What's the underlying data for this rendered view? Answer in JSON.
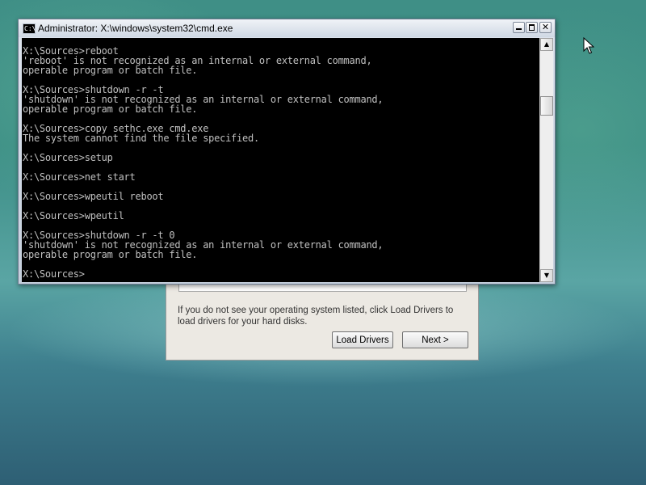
{
  "cmd_window": {
    "title": "Administrator: X:\\windows\\system32\\cmd.exe",
    "icon_text": "C:\\",
    "controls": {
      "minimize": "minimize-icon",
      "maximize": "maximize-icon",
      "close": "close-icon"
    },
    "scrollbar": {
      "up_icon": "up-arrow-icon",
      "down_icon": "down-arrow-icon"
    },
    "console_lines": [
      "X:\\Sources>reboot",
      "'reboot' is not recognized as an internal or external command,",
      "operable program or batch file.",
      "",
      "X:\\Sources>shutdown -r -t",
      "'shutdown' is not recognized as an internal or external command,",
      "operable program or batch file.",
      "",
      "X:\\Sources>copy sethc.exe cmd.exe",
      "The system cannot find the file specified.",
      "",
      "X:\\Sources>setup",
      "",
      "X:\\Sources>net start",
      "",
      "X:\\Sources>wpeutil reboot",
      "",
      "X:\\Sources>wpeutil",
      "",
      "X:\\Sources>shutdown -r -t 0",
      "'shutdown' is not recognized as an internal or external command,",
      "operable program or batch file.",
      "",
      "X:\\Sources>"
    ]
  },
  "setup_dialog": {
    "hint": "If you do not see your operating system listed, click Load Drivers to load drivers for your hard disks.",
    "load_drivers_label": "Load Drivers",
    "next_label": "Next >"
  },
  "colors": {
    "console_background": "#000000",
    "console_text": "#c0c0c0",
    "dialog_background": "#ece9e3"
  }
}
